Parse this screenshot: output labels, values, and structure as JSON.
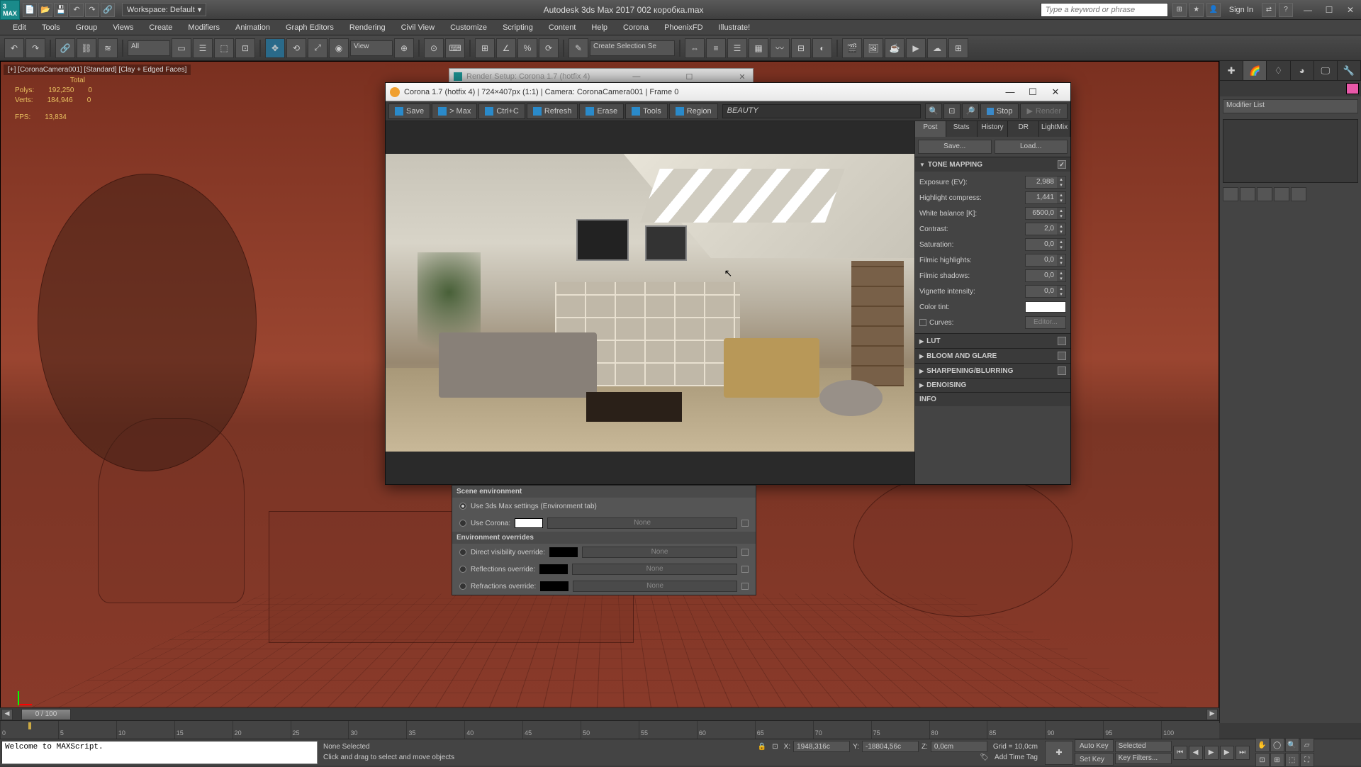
{
  "app": {
    "title": "Autodesk 3ds Max 2017   002 коробка.max",
    "workspace_label": "Workspace: Default",
    "search_placeholder": "Type a keyword or phrase",
    "signin": "Sign In"
  },
  "menu": [
    "Edit",
    "Tools",
    "Group",
    "Views",
    "Create",
    "Modifiers",
    "Animation",
    "Graph Editors",
    "Rendering",
    "Civil View",
    "Customize",
    "Scripting",
    "Content",
    "Help",
    "Corona",
    "PhoenixFD",
    "Illustrate!"
  ],
  "maintb": {
    "all": "All",
    "view": "View",
    "selset": "Create Selection Se"
  },
  "viewport": {
    "label": "[+] [CoronaCamera001] [Standard] [Clay + Edged Faces]",
    "stats_total": "Total",
    "polys": "Polys:",
    "polys_v": "192,250",
    "polys_s": "0",
    "verts": "Verts:",
    "verts_v": "184,946",
    "verts_s": "0",
    "fps": "FPS:",
    "fps_v": "13,834"
  },
  "cmdpanel": {
    "modlist": "Modifier List"
  },
  "rsbar": {
    "title": "Render Setup: Corona 1.7 (hotfix 4)"
  },
  "vfb": {
    "title": "Corona 1.7 (hotfix 4) | 724×407px (1:1) | Camera: CoronaCamera001 | Frame 0",
    "btn_save": "Save",
    "btn_max": "> Max",
    "btn_ctrlc": "Ctrl+C",
    "btn_refresh": "Refresh",
    "btn_erase": "Erase",
    "btn_tools": "Tools",
    "btn_region": "Region",
    "pass": "BEAUTY",
    "btn_stop": "Stop",
    "btn_render": "Render",
    "tabs": [
      "Post",
      "Stats",
      "History",
      "DR",
      "LightMix"
    ],
    "save": "Save...",
    "load": "Load...",
    "sec_tone": "TONE MAPPING",
    "sec_lut": "LUT",
    "sec_bloom": "BLOOM AND GLARE",
    "sec_sharp": "SHARPENING/BLURRING",
    "sec_denoise": "DENOISING",
    "sec_info": "INFO",
    "tone": {
      "exposure_l": "Exposure (EV):",
      "exposure_v": "2,988",
      "highlight_l": "Highlight compress:",
      "highlight_v": "1,441",
      "wb_l": "White balance [K]:",
      "wb_v": "6500,0",
      "contrast_l": "Contrast:",
      "contrast_v": "2,0",
      "sat_l": "Saturation:",
      "sat_v": "0,0",
      "fhi_l": "Filmic highlights:",
      "fhi_v": "0,0",
      "fsh_l": "Filmic shadows:",
      "fsh_v": "0,0",
      "vig_l": "Vignette intensity:",
      "vig_v": "0,0",
      "tint_l": "Color tint:",
      "curves_l": "Curves:",
      "curves_btn": "Editor..."
    }
  },
  "rsenv": {
    "hdr": "Scene environment",
    "use3ds": "Use 3ds Max settings (Environment tab)",
    "usecorona": "Use Corona:",
    "ovr_hdr": "Environment overrides",
    "dvo": "Direct visibility override:",
    "refl": "Reflections override:",
    "refr": "Refractions override:",
    "none": "None"
  },
  "timeline": {
    "frame": "0 / 100",
    "ticks": [
      "0",
      "5",
      "10",
      "15",
      "20",
      "25",
      "30",
      "35",
      "40",
      "45",
      "50",
      "55",
      "60",
      "65",
      "70",
      "75",
      "80",
      "85",
      "90",
      "95",
      "100"
    ]
  },
  "status": {
    "script": "Welcome to MAXScript.",
    "sel": "None Selected",
    "prompt": "Click and drag to select and move objects",
    "x": "X:",
    "xv": "1948,316c",
    "y": "Y:",
    "yv": "-18804,56c",
    "z": "Z:",
    "zv": "0,0cm",
    "grid": "Grid = 10,0cm",
    "addtag": "Add Time Tag",
    "autokey": "Auto Key",
    "setkey": "Set Key",
    "selected": "Selected",
    "keyfilt": "Key Filters..."
  }
}
